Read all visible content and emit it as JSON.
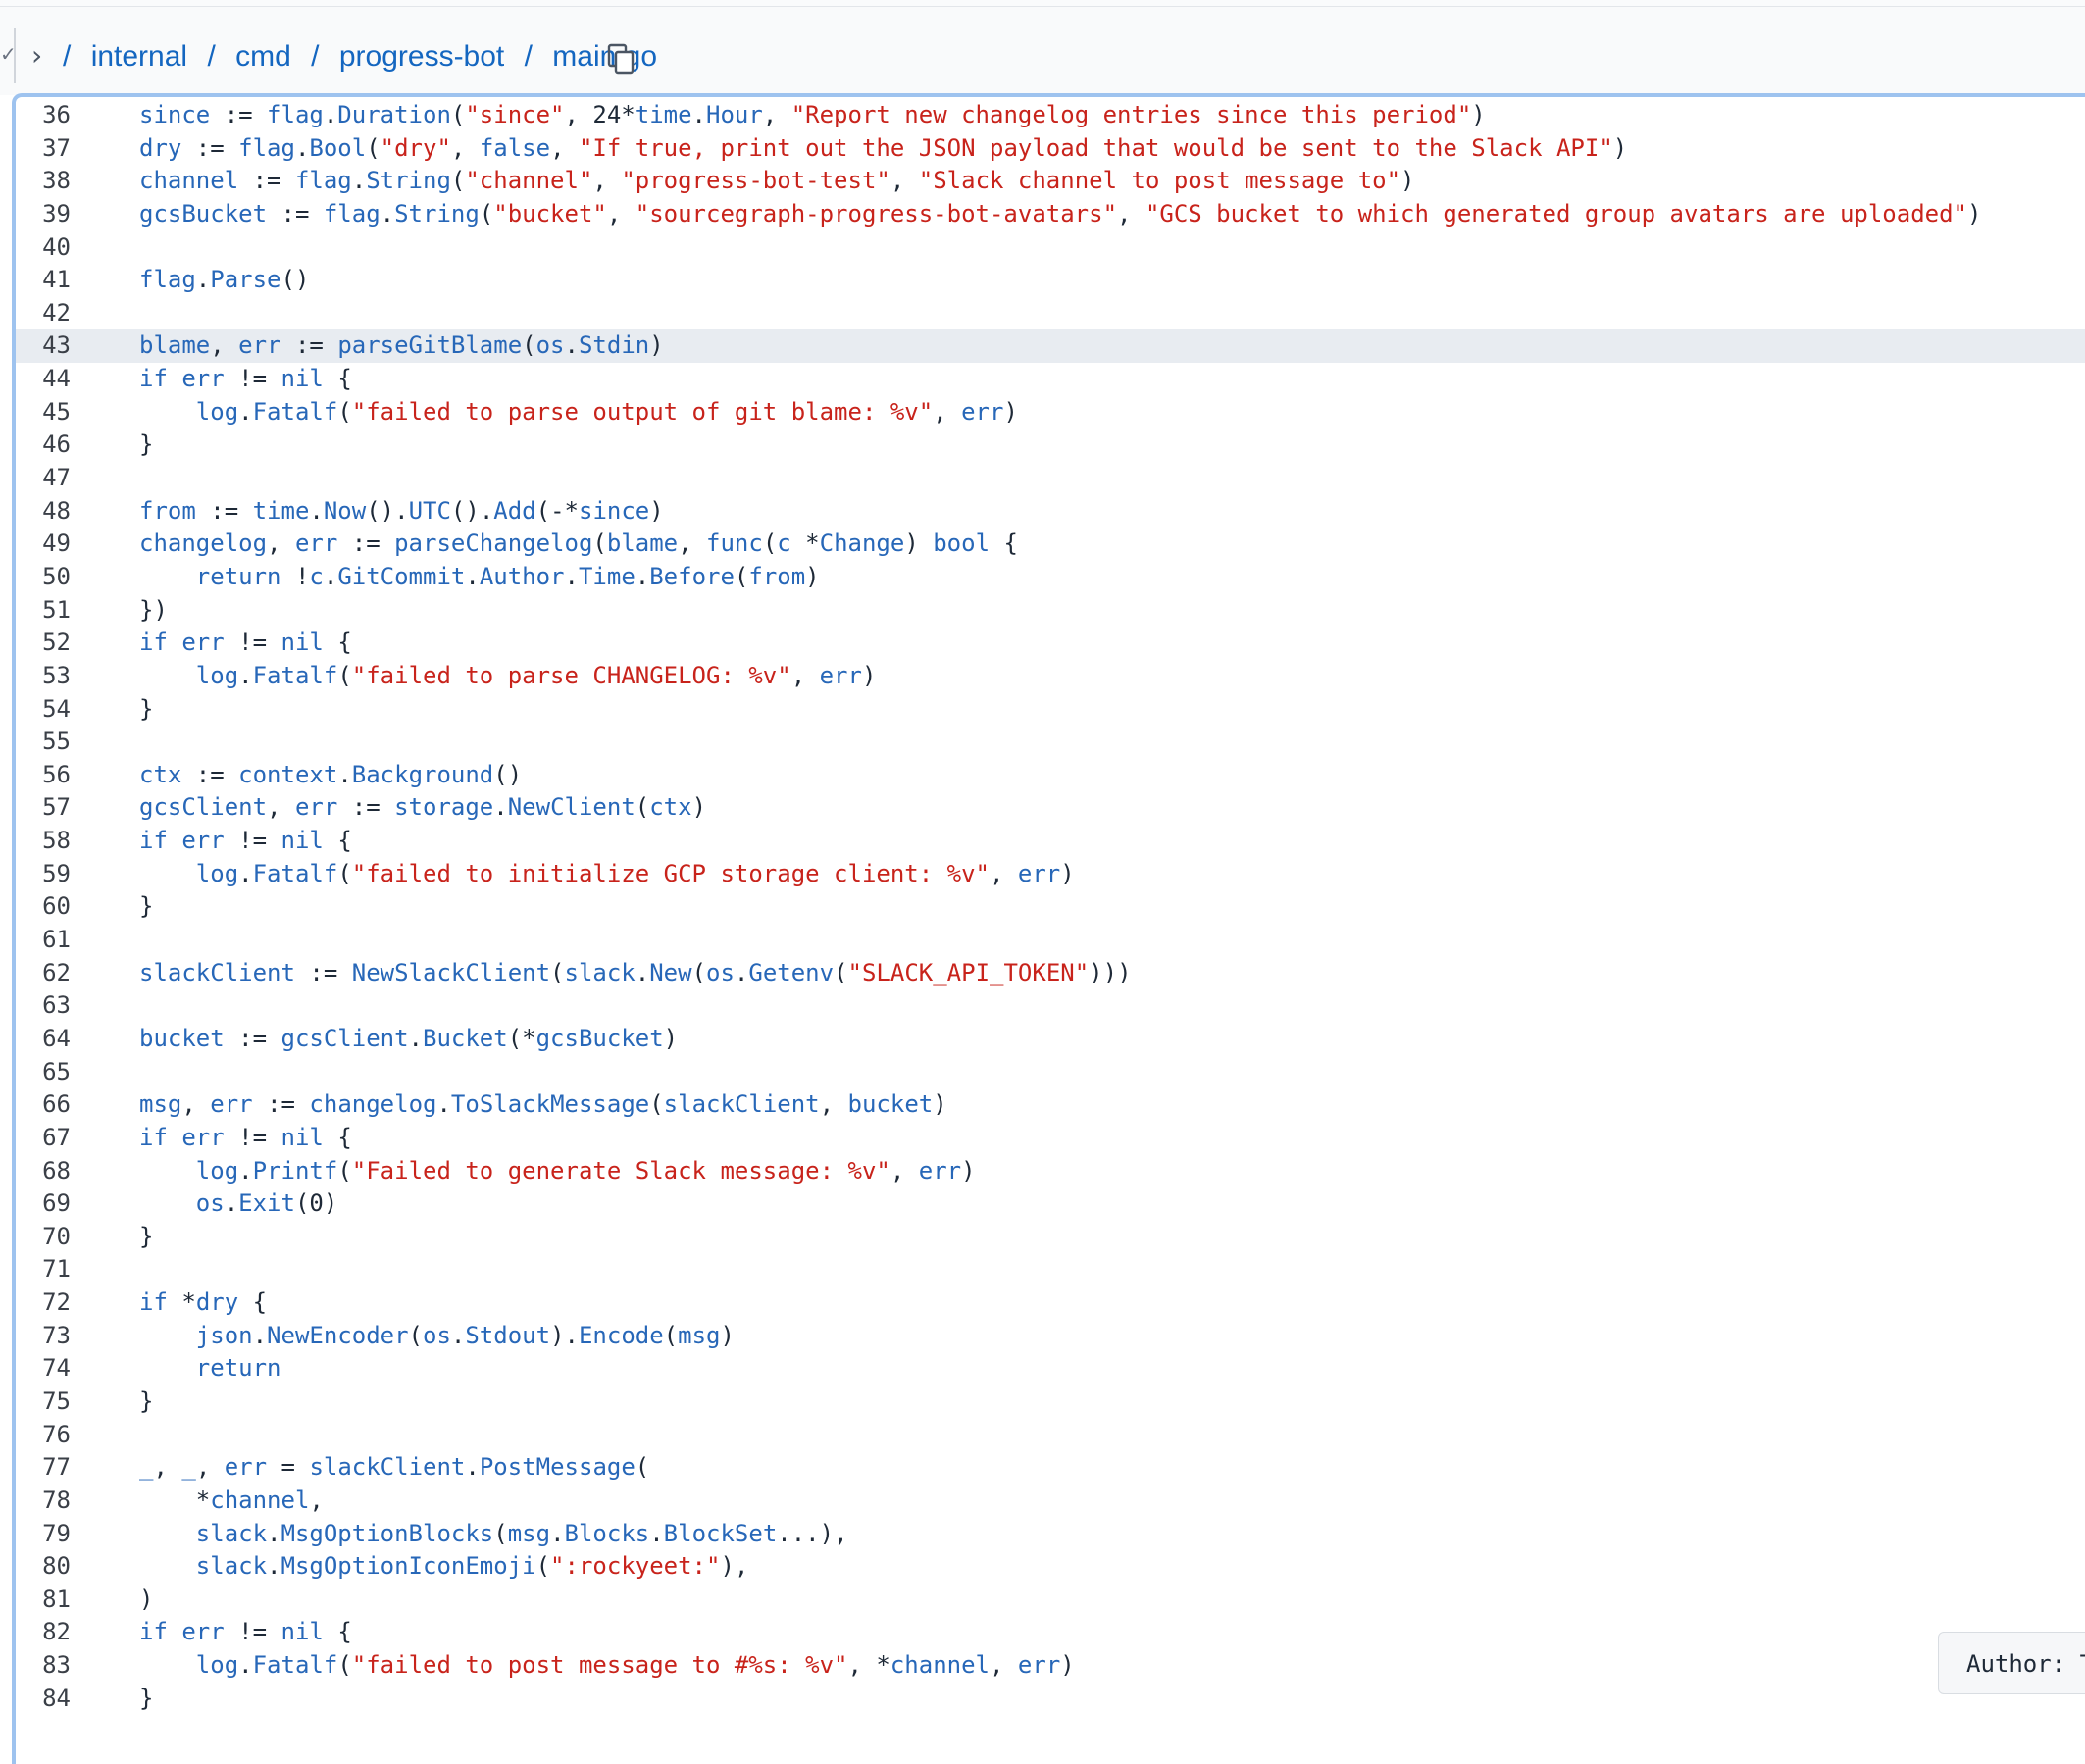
{
  "breadcrumb": {
    "leading_separator": "/",
    "parts": [
      "internal",
      "cmd",
      "progress-bot",
      "main.go"
    ],
    "separator": "/"
  },
  "icons": {
    "collapse": "chevron-right-icon",
    "copy": "copy-icon",
    "check": "check-icon"
  },
  "colors": {
    "keyword_blue": "#2767b8",
    "string_red": "#c8231b",
    "link_blue": "#1466c0",
    "highlight": "#e8ecf1",
    "frame_border": "#9ec3ef"
  },
  "highlighted_line": 43,
  "tooltip": {
    "text": "Author: T"
  },
  "code_lines": [
    {
      "n": "36",
      "tokens": [
        [
          "k",
          "since"
        ],
        [
          "p",
          " := "
        ],
        [
          "k",
          "flag"
        ],
        [
          "p",
          "."
        ],
        [
          "k",
          "Duration"
        ],
        [
          "p",
          "("
        ],
        [
          "s",
          "\"since\""
        ],
        [
          "p",
          ", 24*"
        ],
        [
          "k",
          "time"
        ],
        [
          "p",
          "."
        ],
        [
          "k",
          "Hour"
        ],
        [
          "p",
          ", "
        ],
        [
          "s",
          "\"Report new changelog entries since this period\""
        ],
        [
          "p",
          ")"
        ]
      ]
    },
    {
      "n": "37",
      "tokens": [
        [
          "k",
          "dry"
        ],
        [
          "p",
          " := "
        ],
        [
          "k",
          "flag"
        ],
        [
          "p",
          "."
        ],
        [
          "k",
          "Bool"
        ],
        [
          "p",
          "("
        ],
        [
          "s",
          "\"dry\""
        ],
        [
          "p",
          ", "
        ],
        [
          "k",
          "false"
        ],
        [
          "p",
          ", "
        ],
        [
          "s",
          "\"If true, print out the JSON payload that would be sent to the Slack API\""
        ],
        [
          "p",
          ")"
        ]
      ]
    },
    {
      "n": "38",
      "tokens": [
        [
          "k",
          "channel"
        ],
        [
          "p",
          " := "
        ],
        [
          "k",
          "flag"
        ],
        [
          "p",
          "."
        ],
        [
          "k",
          "String"
        ],
        [
          "p",
          "("
        ],
        [
          "s",
          "\"channel\""
        ],
        [
          "p",
          ", "
        ],
        [
          "s",
          "\"progress-bot-test\""
        ],
        [
          "p",
          ", "
        ],
        [
          "s",
          "\"Slack channel to post message to\""
        ],
        [
          "p",
          ")"
        ]
      ]
    },
    {
      "n": "39",
      "tokens": [
        [
          "k",
          "gcsBucket"
        ],
        [
          "p",
          " := "
        ],
        [
          "k",
          "flag"
        ],
        [
          "p",
          "."
        ],
        [
          "k",
          "String"
        ],
        [
          "p",
          "("
        ],
        [
          "s",
          "\"bucket\""
        ],
        [
          "p",
          ", "
        ],
        [
          "s",
          "\"sourcegraph-progress-bot-avatars\""
        ],
        [
          "p",
          ", "
        ],
        [
          "s",
          "\"GCS bucket to which generated group avatars are uploaded\""
        ],
        [
          "p",
          ")"
        ]
      ]
    },
    {
      "n": "40",
      "tokens": []
    },
    {
      "n": "41",
      "tokens": [
        [
          "k",
          "flag"
        ],
        [
          "p",
          "."
        ],
        [
          "k",
          "Parse"
        ],
        [
          "p",
          "()"
        ]
      ]
    },
    {
      "n": "42",
      "tokens": []
    },
    {
      "n": "43",
      "tokens": [
        [
          "k",
          "blame"
        ],
        [
          "p",
          ", "
        ],
        [
          "k",
          "err"
        ],
        [
          "p",
          " := "
        ],
        [
          "k",
          "parseGitBlame"
        ],
        [
          "p",
          "("
        ],
        [
          "k",
          "os"
        ],
        [
          "p",
          "."
        ],
        [
          "k",
          "Stdin"
        ],
        [
          "p",
          ")"
        ]
      ]
    },
    {
      "n": "44",
      "tokens": [
        [
          "k",
          "if"
        ],
        [
          "p",
          " "
        ],
        [
          "k",
          "err"
        ],
        [
          "p",
          " != "
        ],
        [
          "k",
          "nil"
        ],
        [
          "p",
          " {"
        ]
      ]
    },
    {
      "n": "45",
      "tokens": [
        [
          "p",
          "    "
        ],
        [
          "k",
          "log"
        ],
        [
          "p",
          "."
        ],
        [
          "k",
          "Fatalf"
        ],
        [
          "p",
          "("
        ],
        [
          "s",
          "\"failed to parse output of git blame: %v\""
        ],
        [
          "p",
          ", "
        ],
        [
          "k",
          "err"
        ],
        [
          "p",
          ")"
        ]
      ]
    },
    {
      "n": "46",
      "tokens": [
        [
          "p",
          "}"
        ]
      ]
    },
    {
      "n": "47",
      "tokens": []
    },
    {
      "n": "48",
      "tokens": [
        [
          "k",
          "from"
        ],
        [
          "p",
          " := "
        ],
        [
          "k",
          "time"
        ],
        [
          "p",
          "."
        ],
        [
          "k",
          "Now"
        ],
        [
          "p",
          "()."
        ],
        [
          "k",
          "UTC"
        ],
        [
          "p",
          "()."
        ],
        [
          "k",
          "Add"
        ],
        [
          "p",
          "(-*"
        ],
        [
          "k",
          "since"
        ],
        [
          "p",
          ")"
        ]
      ]
    },
    {
      "n": "49",
      "tokens": [
        [
          "k",
          "changelog"
        ],
        [
          "p",
          ", "
        ],
        [
          "k",
          "err"
        ],
        [
          "p",
          " := "
        ],
        [
          "k",
          "parseChangelog"
        ],
        [
          "p",
          "("
        ],
        [
          "k",
          "blame"
        ],
        [
          "p",
          ", "
        ],
        [
          "k",
          "func"
        ],
        [
          "p",
          "("
        ],
        [
          "k",
          "c"
        ],
        [
          "p",
          " *"
        ],
        [
          "k",
          "Change"
        ],
        [
          "p",
          ") "
        ],
        [
          "k",
          "bool"
        ],
        [
          "p",
          " {"
        ]
      ]
    },
    {
      "n": "50",
      "tokens": [
        [
          "p",
          "    "
        ],
        [
          "k",
          "return"
        ],
        [
          "p",
          " !"
        ],
        [
          "k",
          "c"
        ],
        [
          "p",
          "."
        ],
        [
          "k",
          "GitCommit"
        ],
        [
          "p",
          "."
        ],
        [
          "k",
          "Author"
        ],
        [
          "p",
          "."
        ],
        [
          "k",
          "Time"
        ],
        [
          "p",
          "."
        ],
        [
          "k",
          "Before"
        ],
        [
          "p",
          "("
        ],
        [
          "k",
          "from"
        ],
        [
          "p",
          ")"
        ]
      ]
    },
    {
      "n": "51",
      "tokens": [
        [
          "p",
          "})"
        ]
      ]
    },
    {
      "n": "52",
      "tokens": [
        [
          "k",
          "if"
        ],
        [
          "p",
          " "
        ],
        [
          "k",
          "err"
        ],
        [
          "p",
          " != "
        ],
        [
          "k",
          "nil"
        ],
        [
          "p",
          " {"
        ]
      ]
    },
    {
      "n": "53",
      "tokens": [
        [
          "p",
          "    "
        ],
        [
          "k",
          "log"
        ],
        [
          "p",
          "."
        ],
        [
          "k",
          "Fatalf"
        ],
        [
          "p",
          "("
        ],
        [
          "s",
          "\"failed to parse CHANGELOG: %v\""
        ],
        [
          "p",
          ", "
        ],
        [
          "k",
          "err"
        ],
        [
          "p",
          ")"
        ]
      ]
    },
    {
      "n": "54",
      "tokens": [
        [
          "p",
          "}"
        ]
      ]
    },
    {
      "n": "55",
      "tokens": []
    },
    {
      "n": "56",
      "tokens": [
        [
          "k",
          "ctx"
        ],
        [
          "p",
          " := "
        ],
        [
          "k",
          "context"
        ],
        [
          "p",
          "."
        ],
        [
          "k",
          "Background"
        ],
        [
          "p",
          "()"
        ]
      ]
    },
    {
      "n": "57",
      "tokens": [
        [
          "k",
          "gcsClient"
        ],
        [
          "p",
          ", "
        ],
        [
          "k",
          "err"
        ],
        [
          "p",
          " := "
        ],
        [
          "k",
          "storage"
        ],
        [
          "p",
          "."
        ],
        [
          "k",
          "NewClient"
        ],
        [
          "p",
          "("
        ],
        [
          "k",
          "ctx"
        ],
        [
          "p",
          ")"
        ]
      ]
    },
    {
      "n": "58",
      "tokens": [
        [
          "k",
          "if"
        ],
        [
          "p",
          " "
        ],
        [
          "k",
          "err"
        ],
        [
          "p",
          " != "
        ],
        [
          "k",
          "nil"
        ],
        [
          "p",
          " {"
        ]
      ]
    },
    {
      "n": "59",
      "tokens": [
        [
          "p",
          "    "
        ],
        [
          "k",
          "log"
        ],
        [
          "p",
          "."
        ],
        [
          "k",
          "Fatalf"
        ],
        [
          "p",
          "("
        ],
        [
          "s",
          "\"failed to initialize GCP storage client: %v\""
        ],
        [
          "p",
          ", "
        ],
        [
          "k",
          "err"
        ],
        [
          "p",
          ")"
        ]
      ]
    },
    {
      "n": "60",
      "tokens": [
        [
          "p",
          "}"
        ]
      ]
    },
    {
      "n": "61",
      "tokens": []
    },
    {
      "n": "62",
      "tokens": [
        [
          "k",
          "slackClient"
        ],
        [
          "p",
          " := "
        ],
        [
          "k",
          "NewSlackClient"
        ],
        [
          "p",
          "("
        ],
        [
          "k",
          "slack"
        ],
        [
          "p",
          "."
        ],
        [
          "k",
          "New"
        ],
        [
          "p",
          "("
        ],
        [
          "k",
          "os"
        ],
        [
          "p",
          "."
        ],
        [
          "k",
          "Getenv"
        ],
        [
          "p",
          "("
        ],
        [
          "s",
          "\"SLACK_API_TOKEN\""
        ],
        [
          "p",
          ")))"
        ]
      ]
    },
    {
      "n": "63",
      "tokens": []
    },
    {
      "n": "64",
      "tokens": [
        [
          "k",
          "bucket"
        ],
        [
          "p",
          " := "
        ],
        [
          "k",
          "gcsClient"
        ],
        [
          "p",
          "."
        ],
        [
          "k",
          "Bucket"
        ],
        [
          "p",
          "(*"
        ],
        [
          "k",
          "gcsBucket"
        ],
        [
          "p",
          ")"
        ]
      ]
    },
    {
      "n": "65",
      "tokens": []
    },
    {
      "n": "66",
      "tokens": [
        [
          "k",
          "msg"
        ],
        [
          "p",
          ", "
        ],
        [
          "k",
          "err"
        ],
        [
          "p",
          " := "
        ],
        [
          "k",
          "changelog"
        ],
        [
          "p",
          "."
        ],
        [
          "k",
          "ToSlackMessage"
        ],
        [
          "p",
          "("
        ],
        [
          "k",
          "slackClient"
        ],
        [
          "p",
          ", "
        ],
        [
          "k",
          "bucket"
        ],
        [
          "p",
          ")"
        ]
      ]
    },
    {
      "n": "67",
      "tokens": [
        [
          "k",
          "if"
        ],
        [
          "p",
          " "
        ],
        [
          "k",
          "err"
        ],
        [
          "p",
          " != "
        ],
        [
          "k",
          "nil"
        ],
        [
          "p",
          " {"
        ]
      ]
    },
    {
      "n": "68",
      "tokens": [
        [
          "p",
          "    "
        ],
        [
          "k",
          "log"
        ],
        [
          "p",
          "."
        ],
        [
          "k",
          "Printf"
        ],
        [
          "p",
          "("
        ],
        [
          "s",
          "\"Failed to generate Slack message: %v\""
        ],
        [
          "p",
          ", "
        ],
        [
          "k",
          "err"
        ],
        [
          "p",
          ")"
        ]
      ]
    },
    {
      "n": "69",
      "tokens": [
        [
          "p",
          "    "
        ],
        [
          "k",
          "os"
        ],
        [
          "p",
          "."
        ],
        [
          "k",
          "Exit"
        ],
        [
          "p",
          "(0)"
        ]
      ]
    },
    {
      "n": "70",
      "tokens": [
        [
          "p",
          "}"
        ]
      ]
    },
    {
      "n": "71",
      "tokens": []
    },
    {
      "n": "72",
      "tokens": [
        [
          "k",
          "if"
        ],
        [
          "p",
          " *"
        ],
        [
          "k",
          "dry"
        ],
        [
          "p",
          " {"
        ]
      ]
    },
    {
      "n": "73",
      "tokens": [
        [
          "p",
          "    "
        ],
        [
          "k",
          "json"
        ],
        [
          "p",
          "."
        ],
        [
          "k",
          "NewEncoder"
        ],
        [
          "p",
          "("
        ],
        [
          "k",
          "os"
        ],
        [
          "p",
          "."
        ],
        [
          "k",
          "Stdout"
        ],
        [
          "p",
          ")."
        ],
        [
          "k",
          "Encode"
        ],
        [
          "p",
          "("
        ],
        [
          "k",
          "msg"
        ],
        [
          "p",
          ")"
        ]
      ]
    },
    {
      "n": "74",
      "tokens": [
        [
          "p",
          "    "
        ],
        [
          "k",
          "return"
        ]
      ]
    },
    {
      "n": "75",
      "tokens": [
        [
          "p",
          "}"
        ]
      ]
    },
    {
      "n": "76",
      "tokens": []
    },
    {
      "n": "77",
      "tokens": [
        [
          "k",
          "_"
        ],
        [
          "p",
          ", "
        ],
        [
          "k",
          "_"
        ],
        [
          "p",
          ", "
        ],
        [
          "k",
          "err"
        ],
        [
          "p",
          " = "
        ],
        [
          "k",
          "slackClient"
        ],
        [
          "p",
          "."
        ],
        [
          "k",
          "PostMessage"
        ],
        [
          "p",
          "("
        ]
      ]
    },
    {
      "n": "78",
      "tokens": [
        [
          "p",
          "    *"
        ],
        [
          "k",
          "channel"
        ],
        [
          "p",
          ","
        ]
      ]
    },
    {
      "n": "79",
      "tokens": [
        [
          "p",
          "    "
        ],
        [
          "k",
          "slack"
        ],
        [
          "p",
          "."
        ],
        [
          "k",
          "MsgOptionBlocks"
        ],
        [
          "p",
          "("
        ],
        [
          "k",
          "msg"
        ],
        [
          "p",
          "."
        ],
        [
          "k",
          "Blocks"
        ],
        [
          "p",
          "."
        ],
        [
          "k",
          "BlockSet"
        ],
        [
          "p",
          "...),"
        ]
      ]
    },
    {
      "n": "80",
      "tokens": [
        [
          "p",
          "    "
        ],
        [
          "k",
          "slack"
        ],
        [
          "p",
          "."
        ],
        [
          "k",
          "MsgOptionIconEmoji"
        ],
        [
          "p",
          "("
        ],
        [
          "s",
          "\":rockyeet:\""
        ],
        [
          "p",
          "),"
        ]
      ]
    },
    {
      "n": "81",
      "tokens": [
        [
          "p",
          ")"
        ]
      ]
    },
    {
      "n": "82",
      "tokens": [
        [
          "k",
          "if"
        ],
        [
          "p",
          " "
        ],
        [
          "k",
          "err"
        ],
        [
          "p",
          " != "
        ],
        [
          "k",
          "nil"
        ],
        [
          "p",
          " {"
        ]
      ]
    },
    {
      "n": "83",
      "tokens": [
        [
          "p",
          "    "
        ],
        [
          "k",
          "log"
        ],
        [
          "p",
          "."
        ],
        [
          "k",
          "Fatalf"
        ],
        [
          "p",
          "("
        ],
        [
          "s",
          "\"failed to post message to #%s: %v\""
        ],
        [
          "p",
          ", *"
        ],
        [
          "k",
          "channel"
        ],
        [
          "p",
          ", "
        ],
        [
          "k",
          "err"
        ],
        [
          "p",
          ")"
        ]
      ]
    },
    {
      "n": "84",
      "tokens": [
        [
          "p",
          "}"
        ]
      ]
    }
  ]
}
